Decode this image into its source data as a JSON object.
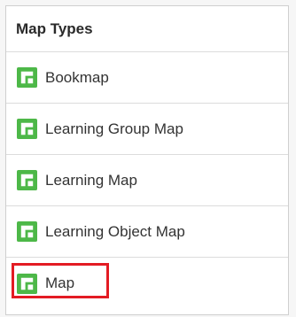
{
  "panel": {
    "title": "Map Types"
  },
  "items": [
    {
      "label": "Bookmap",
      "icon": "map-icon"
    },
    {
      "label": "Learning Group Map",
      "icon": "map-icon"
    },
    {
      "label": "Learning Map",
      "icon": "map-icon"
    },
    {
      "label": "Learning Object Map",
      "icon": "map-icon"
    },
    {
      "label": "Map",
      "icon": "map-icon",
      "highlighted": true
    }
  ],
  "colors": {
    "icon_green": "#4db848",
    "highlight_red": "#e31b23"
  }
}
